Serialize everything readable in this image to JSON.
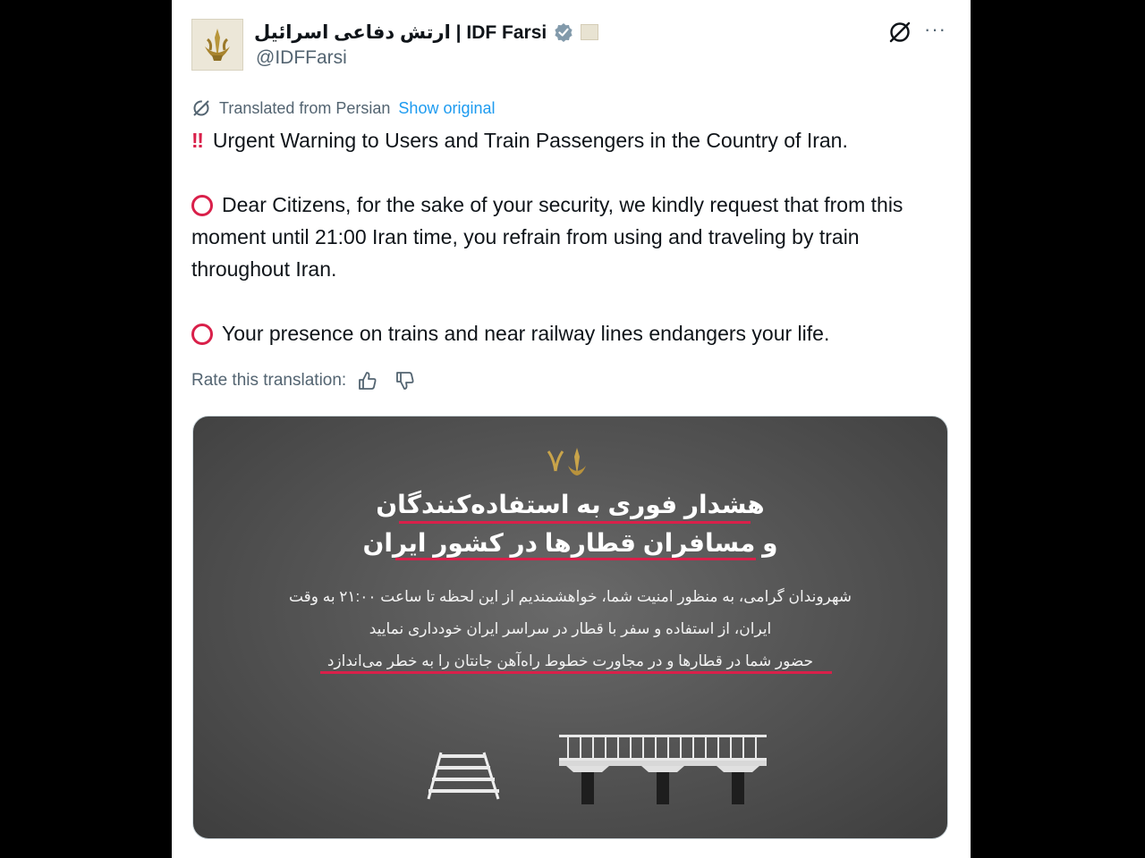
{
  "header": {
    "display_name": "ارتش دفاعی اسرائیل | IDF Farsi",
    "handle": "@IDFFarsi",
    "more_label": "···"
  },
  "translation": {
    "from_label": "Translated from Persian",
    "show_original": "Show original",
    "rate_label": "Rate this translation:"
  },
  "post": {
    "line1": "Urgent Warning to Users and Train Passengers in the Country of Iran.",
    "line1_emoji": "‼",
    "para2": "Dear Citizens, for the sake of your security, we kindly request that from this moment until 21:00 Iran time, you refrain from using and traveling by train throughout Iran.",
    "para3": "Your presence on trains and near railway lines endangers your life."
  },
  "media": {
    "title_line1": "هشدار فوری به استفاده‌کنندگان",
    "title_line2": "و مسافران قطارها در کشور ایران",
    "text_line1": "شهروندان گرامی، به منظور امنیت شما، خواهشمندیم از این لحظه تا ساعت ۲۱:۰۰ به وقت",
    "text_line2": "ایران، از استفاده و سفر با قطار در سراسر ایران خودداری نمایید",
    "text_line3": "حضور شما در قطارها و در مجاورت خطوط راه‌آهن جانتان را به خطر می‌اندازد"
  },
  "colors": {
    "accent_blue": "#1d9bf0",
    "warning_red": "#d9204a",
    "secondary_text": "#536471"
  },
  "icons": [
    "verified-badge-icon",
    "grok-icon",
    "more-icon",
    "translate-icon",
    "thumbs-up-icon",
    "thumbs-down-icon",
    "idf-emblem-icon"
  ]
}
